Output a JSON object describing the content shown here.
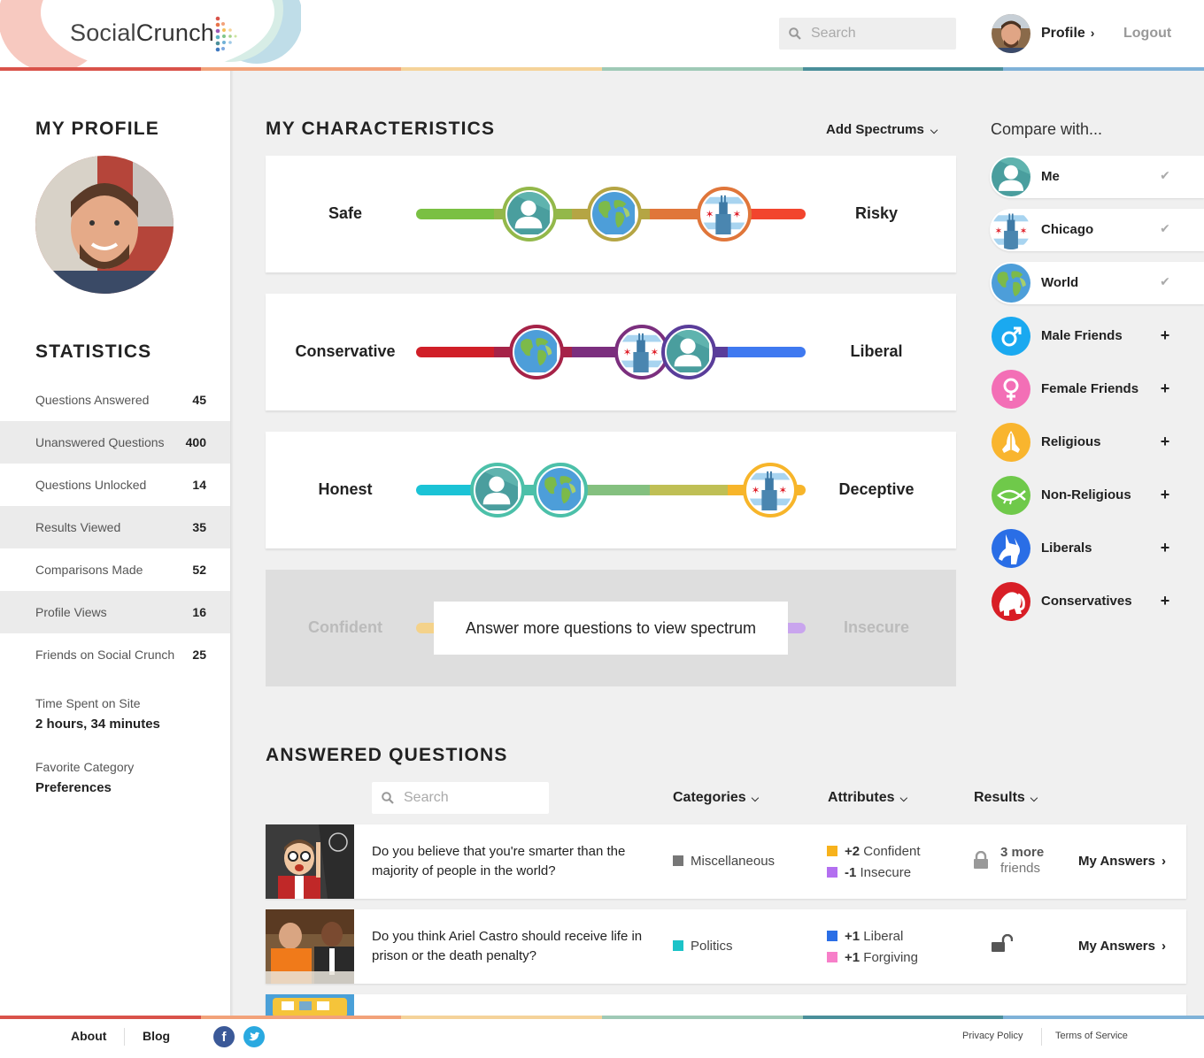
{
  "header": {
    "logo_part1": "Social",
    "logo_part2": "Crunch",
    "search_placeholder": "Search",
    "profile_label": "Profile",
    "logout_label": "Logout"
  },
  "rainbow_colors": [
    "#d9534a",
    "#f2a27a",
    "#f5d39a",
    "#9fc9b6",
    "#4a8f9a",
    "#7fb2d8"
  ],
  "sidebar": {
    "profile_heading": "MY PROFILE",
    "statistics_heading": "STATISTICS",
    "stats": [
      {
        "label": "Questions Answered",
        "value": "45"
      },
      {
        "label": "Unanswered Questions",
        "value": "400"
      },
      {
        "label": "Questions Unlocked",
        "value": "14"
      },
      {
        "label": "Results Viewed",
        "value": "35"
      },
      {
        "label": "Comparisons Made",
        "value": "52"
      },
      {
        "label": "Profile Views",
        "value": "16"
      },
      {
        "label": "Friends on Social Crunch",
        "value": "25"
      }
    ],
    "time_spent_label": "Time Spent on Site",
    "time_spent_value": "2 hours, 34 minutes",
    "favorite_label": "Favorite Category",
    "favorite_value": "Preferences"
  },
  "characteristics": {
    "heading": "MY CHARACTERISTICS",
    "add_spectrums": "Add Spectrums",
    "spectrums": [
      {
        "left": "Safe",
        "right": "Risky",
        "colors": [
          "#7ac043",
          "#93b84a",
          "#b5a544",
          "#e0763a",
          "#f2452e"
        ],
        "markers": [
          {
            "who": "me",
            "pos": 0.29
          },
          {
            "who": "world",
            "pos": 0.51
          },
          {
            "who": "chicago",
            "pos": 0.79
          }
        ]
      },
      {
        "left": "Conservative",
        "right": "Liberal",
        "colors": [
          "#d01f28",
          "#a62348",
          "#7b2f7e",
          "#5a3d9a",
          "#3f79f0"
        ],
        "markers": [
          {
            "who": "world",
            "pos": 0.31
          },
          {
            "who": "chicago",
            "pos": 0.58
          },
          {
            "who": "me",
            "pos": 0.7
          }
        ]
      },
      {
        "left": "Honest",
        "right": "Deceptive",
        "colors": [
          "#1bc3d6",
          "#4cc0a9",
          "#84c07f",
          "#bfbf55",
          "#f7b52a"
        ],
        "markers": [
          {
            "who": "me",
            "pos": 0.21
          },
          {
            "who": "world",
            "pos": 0.37
          },
          {
            "who": "chicago",
            "pos": 0.91
          }
        ]
      }
    ],
    "locked": {
      "left": "Confident",
      "right": "Insecure",
      "message": "Answer more questions to view spectrum",
      "left_color": "#f4d28a",
      "right_color": "#c9a5ee"
    }
  },
  "compare": {
    "title": "Compare with...",
    "items": [
      {
        "name": "Me",
        "icon": "user-icon",
        "selected": true,
        "color": "#4a9e9e"
      },
      {
        "name": "Chicago",
        "icon": "chicago-flag-icon",
        "selected": true,
        "color": "#a8d4f0"
      },
      {
        "name": "World",
        "icon": "globe-icon",
        "selected": true,
        "color": "#4d9ed9"
      },
      {
        "name": "Male Friends",
        "icon": "male-icon",
        "selected": false,
        "color": "#1aa9f0"
      },
      {
        "name": "Female Friends",
        "icon": "female-icon",
        "selected": false,
        "color": "#f36fb6"
      },
      {
        "name": "Religious",
        "icon": "praying-hands-icon",
        "selected": false,
        "color": "#f9b52e"
      },
      {
        "name": "Non-Religious",
        "icon": "fish-darwin-icon",
        "selected": false,
        "color": "#6fc94a"
      },
      {
        "name": "Liberals",
        "icon": "donkey-icon",
        "selected": false,
        "color": "#2a6ee6"
      },
      {
        "name": "Conservatives",
        "icon": "elephant-icon",
        "selected": false,
        "color": "#d81e26"
      }
    ]
  },
  "answered": {
    "heading": "ANSWERED QUESTIONS",
    "search_placeholder": "Search",
    "filters": [
      "Categories",
      "Attributes",
      "Results"
    ],
    "questions": [
      {
        "text": "Do you believe that you're smarter than the majority of people in the world?",
        "category": "Miscellaneous",
        "category_color": "#777777",
        "attributes": [
          {
            "delta": "+2",
            "name": "Confident",
            "color": "#f7b21c"
          },
          {
            "delta": "-1",
            "name": "Insecure",
            "color": "#b36ff0"
          }
        ],
        "result_line1": "3 more",
        "result_line2": "friends",
        "locked": true,
        "my_answers": "My Answers"
      },
      {
        "text": "Do you think Ariel Castro should receive life in prison or the death penalty?",
        "category": "Politics",
        "category_color": "#1bc3c8",
        "attributes": [
          {
            "delta": "+1",
            "name": "Liberal",
            "color": "#2a6ee6"
          },
          {
            "delta": "+1",
            "name": "Forgiving",
            "color": "#f77fc9"
          }
        ],
        "locked": false,
        "my_answers": "My Answers"
      }
    ]
  },
  "footer": {
    "about": "About",
    "blog": "Blog",
    "privacy": "Privacy Policy",
    "terms": "Terms of Service",
    "facebook_color": "#3b5998",
    "twitter_color": "#2aa9e0"
  }
}
